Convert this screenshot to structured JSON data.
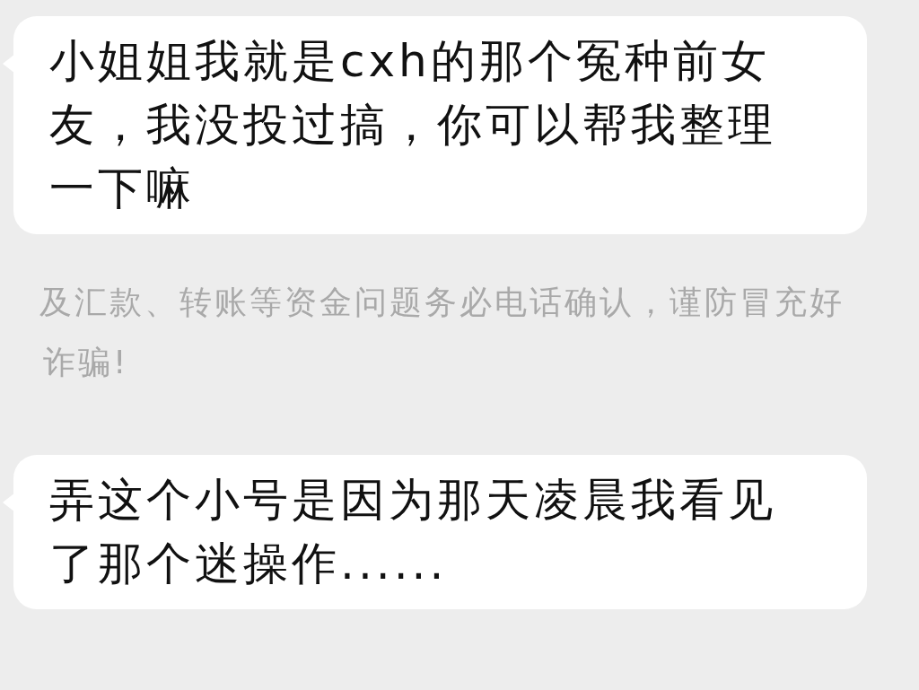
{
  "messages": [
    {
      "kind": "bubble",
      "lines": [
        "小姐姐我就是cxh的那个冤种前女",
        "友，我没投过搞，你可以帮我整理",
        "一下嘛"
      ]
    },
    {
      "kind": "notice",
      "lines": [
        "及汇款、转账等资金问题务必电话确认，谨防冒充好",
        "诈骗!"
      ]
    },
    {
      "kind": "bubble",
      "lines": [
        "弄这个小号是因为那天凌晨我看见",
        "了那个迷操作......"
      ]
    }
  ]
}
